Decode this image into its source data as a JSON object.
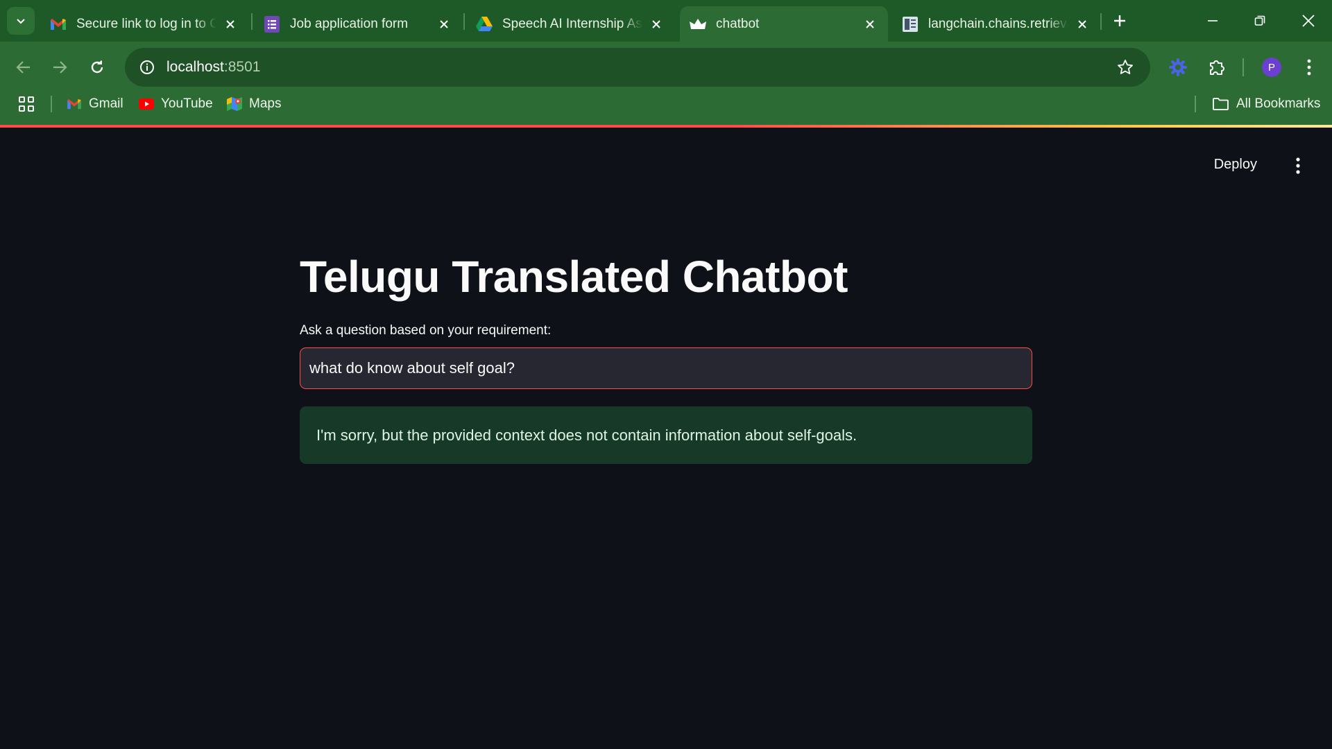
{
  "browser": {
    "tabs": [
      {
        "title": "Secure link to log in to Cl",
        "favicon": "gmail-icon",
        "active": false
      },
      {
        "title": "Job application form",
        "favicon": "forms-icon",
        "active": false
      },
      {
        "title": "Speech AI Internship Assi",
        "favicon": "drive-icon",
        "active": false
      },
      {
        "title": "chatbot",
        "favicon": "streamlit-icon",
        "active": true
      },
      {
        "title": "langchain.chains.retrieval",
        "favicon": "docs-icon",
        "active": false
      }
    ],
    "address": {
      "host": "localhost",
      "port": ":8501"
    },
    "bookmarks": [
      {
        "label": "Gmail",
        "icon": "gmail-icon"
      },
      {
        "label": "YouTube",
        "icon": "youtube-icon"
      },
      {
        "label": "Maps",
        "icon": "maps-icon"
      }
    ],
    "all_bookmarks_label": "All Bookmarks",
    "profile_initial": "P",
    "colors": {
      "frame": "#1e5a28",
      "toolbar": "#2d6b35",
      "accent": "#ff4b4b"
    }
  },
  "app": {
    "deploy_label": "Deploy",
    "title": "Telugu Translated Chatbot",
    "input_label": "Ask a question based on your requirement:",
    "input_value": "what do know about self goal?",
    "answer": "I'm sorry, but the provided context does not contain information about self-goals.",
    "colors": {
      "background": "#0e1117",
      "input_bg": "#262730",
      "success_bg": "#173928",
      "focus_border": "#ff4b4b"
    }
  }
}
